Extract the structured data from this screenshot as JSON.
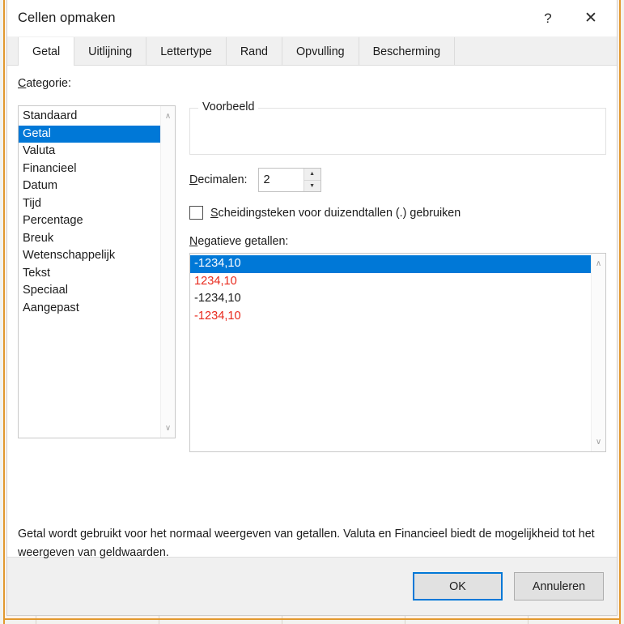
{
  "window": {
    "title": "Cellen opmaken",
    "help_icon": "help-question-icon",
    "help_glyph": "?",
    "close_icon": "close-icon",
    "close_glyph": "✕",
    "accent_color": "#0078d7",
    "negative_red": "#e8291c"
  },
  "tabs": [
    {
      "label": "Getal",
      "active": true
    },
    {
      "label": "Uitlijning",
      "active": false
    },
    {
      "label": "Lettertype",
      "active": false
    },
    {
      "label": "Rand",
      "active": false
    },
    {
      "label": "Opvulling",
      "active": false
    },
    {
      "label": "Bescherming",
      "active": false
    }
  ],
  "category": {
    "label_accel": "C",
    "label_rest": "ategorie:",
    "items": [
      {
        "label": "Standaard",
        "selected": false
      },
      {
        "label": "Getal",
        "selected": true
      },
      {
        "label": "Valuta",
        "selected": false
      },
      {
        "label": "Financieel",
        "selected": false
      },
      {
        "label": "Datum",
        "selected": false
      },
      {
        "label": "Tijd",
        "selected": false
      },
      {
        "label": "Percentage",
        "selected": false
      },
      {
        "label": "Breuk",
        "selected": false
      },
      {
        "label": "Wetenschappelijk",
        "selected": false
      },
      {
        "label": "Tekst",
        "selected": false
      },
      {
        "label": "Speciaal",
        "selected": false
      },
      {
        "label": "Aangepast",
        "selected": false
      }
    ]
  },
  "preview": {
    "title": "Voorbeeld",
    "value": ""
  },
  "decimals": {
    "label_accel": "D",
    "label_rest": "ecimalen:",
    "value": "2",
    "up_glyph": "▲",
    "down_glyph": "▼"
  },
  "thousands_separator": {
    "checked": false,
    "label_accel": "S",
    "label_rest": "cheidingsteken voor duizendtallen (.) gebruiken"
  },
  "negative_numbers": {
    "label_accel": "N",
    "label_rest": "egatieve getallen:",
    "items": [
      {
        "label": "-1234,10",
        "selected": true,
        "red": false
      },
      {
        "label": "1234,10",
        "selected": false,
        "red": true
      },
      {
        "label": "-1234,10",
        "selected": false,
        "red": false
      },
      {
        "label": "-1234,10",
        "selected": false,
        "red": true
      }
    ]
  },
  "description": "Getal wordt gebruikt voor het normaal weergeven van getallen. Valuta en Financieel biedt de mogelijkheid tot het weergeven van geldwaarden.",
  "scrollbar": {
    "up_glyph": "∧",
    "down_glyph": "∨"
  },
  "footer": {
    "ok_label": "OK",
    "cancel_label": "Annuleren"
  }
}
